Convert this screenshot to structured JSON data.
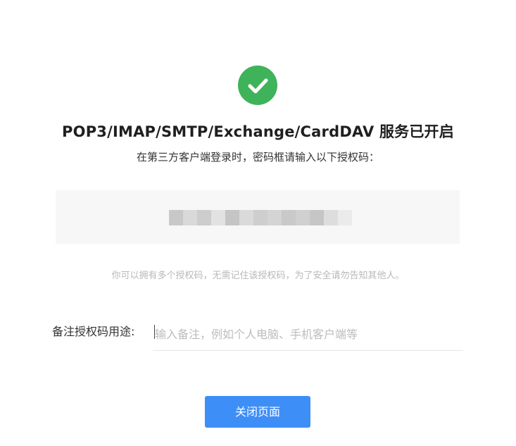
{
  "status_icon": "check-icon",
  "title": "POP3/IMAP/SMTP/Exchange/CardDAV 服务已开启",
  "subtitle": "在第三方客户端登录时，密码框请输入以下授权码：",
  "auth_code": {
    "masked": true
  },
  "hint": "你可以拥有多个授权码，无需记住该授权码，为了安全请勿告知其他人。",
  "remark": {
    "label": "备注授权码用途:",
    "placeholder": "输入备注，例如个人电脑、手机客户端等",
    "value": ""
  },
  "close_button": {
    "label": "关闭页面"
  },
  "colors": {
    "success": "#3fb35a",
    "primary": "#3e8ef7",
    "code_box_bg": "#f7f7f7",
    "hint_text": "#b8b8b8"
  }
}
